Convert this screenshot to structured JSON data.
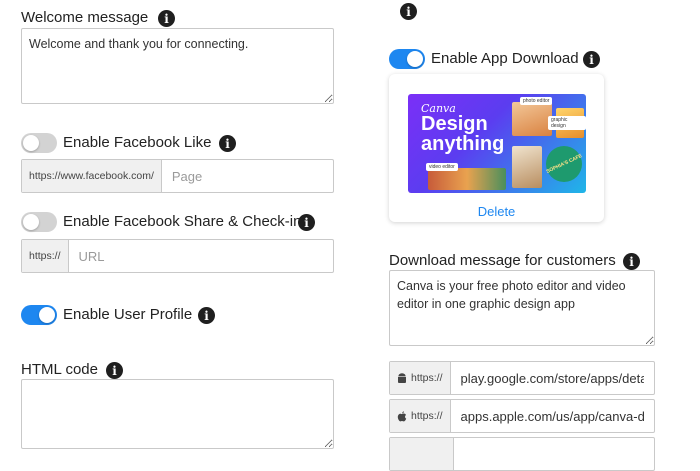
{
  "welcome": {
    "label": "Welcome message",
    "value": "Welcome and thank you for connecting."
  },
  "facebook_like": {
    "label": "Enable Facebook Like",
    "enabled": false,
    "prefix": "https://www.facebook.com/",
    "placeholder": "Page"
  },
  "facebook_share": {
    "label": "Enable Facebook Share & Check-in",
    "enabled": false,
    "prefix": "https://",
    "placeholder": "URL"
  },
  "user_profile": {
    "label": "Enable User Profile",
    "enabled": true
  },
  "html_code": {
    "label": "HTML code",
    "value": ""
  },
  "app_download": {
    "label": "Enable App Download",
    "enabled": true,
    "banner": {
      "brand": "Canva",
      "headline_line1": "Design",
      "headline_line2": "anything",
      "tag_photo": "photo editor",
      "tag_graphic": "graphic design",
      "tag_video": "video editor",
      "tag_cafe": "SOPHIA'S CAFE"
    },
    "delete_label": "Delete"
  },
  "download_message": {
    "label": "Download message for customers",
    "value": "Canva is your free photo editor and video editor in one graphic design app"
  },
  "store_links": [
    {
      "icon": "android-icon",
      "prefix": "https://",
      "value": "play.google.com/store/apps/deta"
    },
    {
      "icon": "apple-icon",
      "prefix": "https://",
      "value": "apps.apple.com/us/app/canva-d"
    }
  ],
  "info_glyph": "i",
  "colors": {
    "accent": "#1e87f0",
    "toggle_off": "#d3d3d3",
    "banner_bg": "#6a2ee8"
  }
}
